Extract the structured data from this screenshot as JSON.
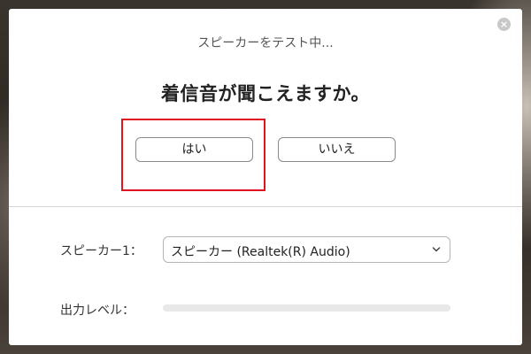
{
  "dialog": {
    "close_icon": "close-icon",
    "testing_label": "スピーカーをテスト中...",
    "question": "着信音が聞こえますか。",
    "yes_label": "はい",
    "no_label": "いいえ",
    "highlight_color": "#e0141e"
  },
  "speaker": {
    "label": "スピーカー1：",
    "selected": "スピーカー (Realtek(R) Audio)",
    "dropdown_icon": "chevron-down-icon"
  },
  "output": {
    "label": "出力レベル：",
    "level_fraction": 0
  }
}
